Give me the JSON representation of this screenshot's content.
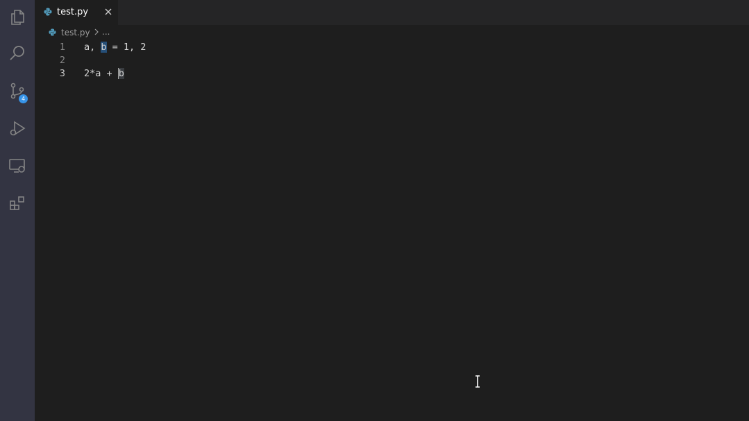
{
  "tab": {
    "label": "test.py",
    "close_glyph": "✕",
    "file_icon": "python-file-icon"
  },
  "breadcrumb": {
    "file": "test.py",
    "ellipsis": "..."
  },
  "activity_bar": {
    "items": [
      {
        "name": "explorer-icon"
      },
      {
        "name": "search-icon"
      },
      {
        "name": "source-control-icon",
        "badge": "4"
      },
      {
        "name": "run-debug-icon"
      },
      {
        "name": "remote-explorer-icon"
      },
      {
        "name": "extensions-icon"
      }
    ]
  },
  "editor": {
    "lines": [
      {
        "number": "1",
        "pre": "a, ",
        "hl": "b",
        "post": " = 1, 2"
      },
      {
        "number": "2",
        "pre": "",
        "hl": "",
        "post": ""
      },
      {
        "number": "3",
        "pre": "2*a + ",
        "hl": "b",
        "post": ""
      }
    ]
  },
  "colors": {
    "editor_bg": "#1e1e1e",
    "activity_bar_bg": "#333442",
    "badge": "#3794e8",
    "python_icon": "#519aba",
    "selection": "#264f78"
  }
}
